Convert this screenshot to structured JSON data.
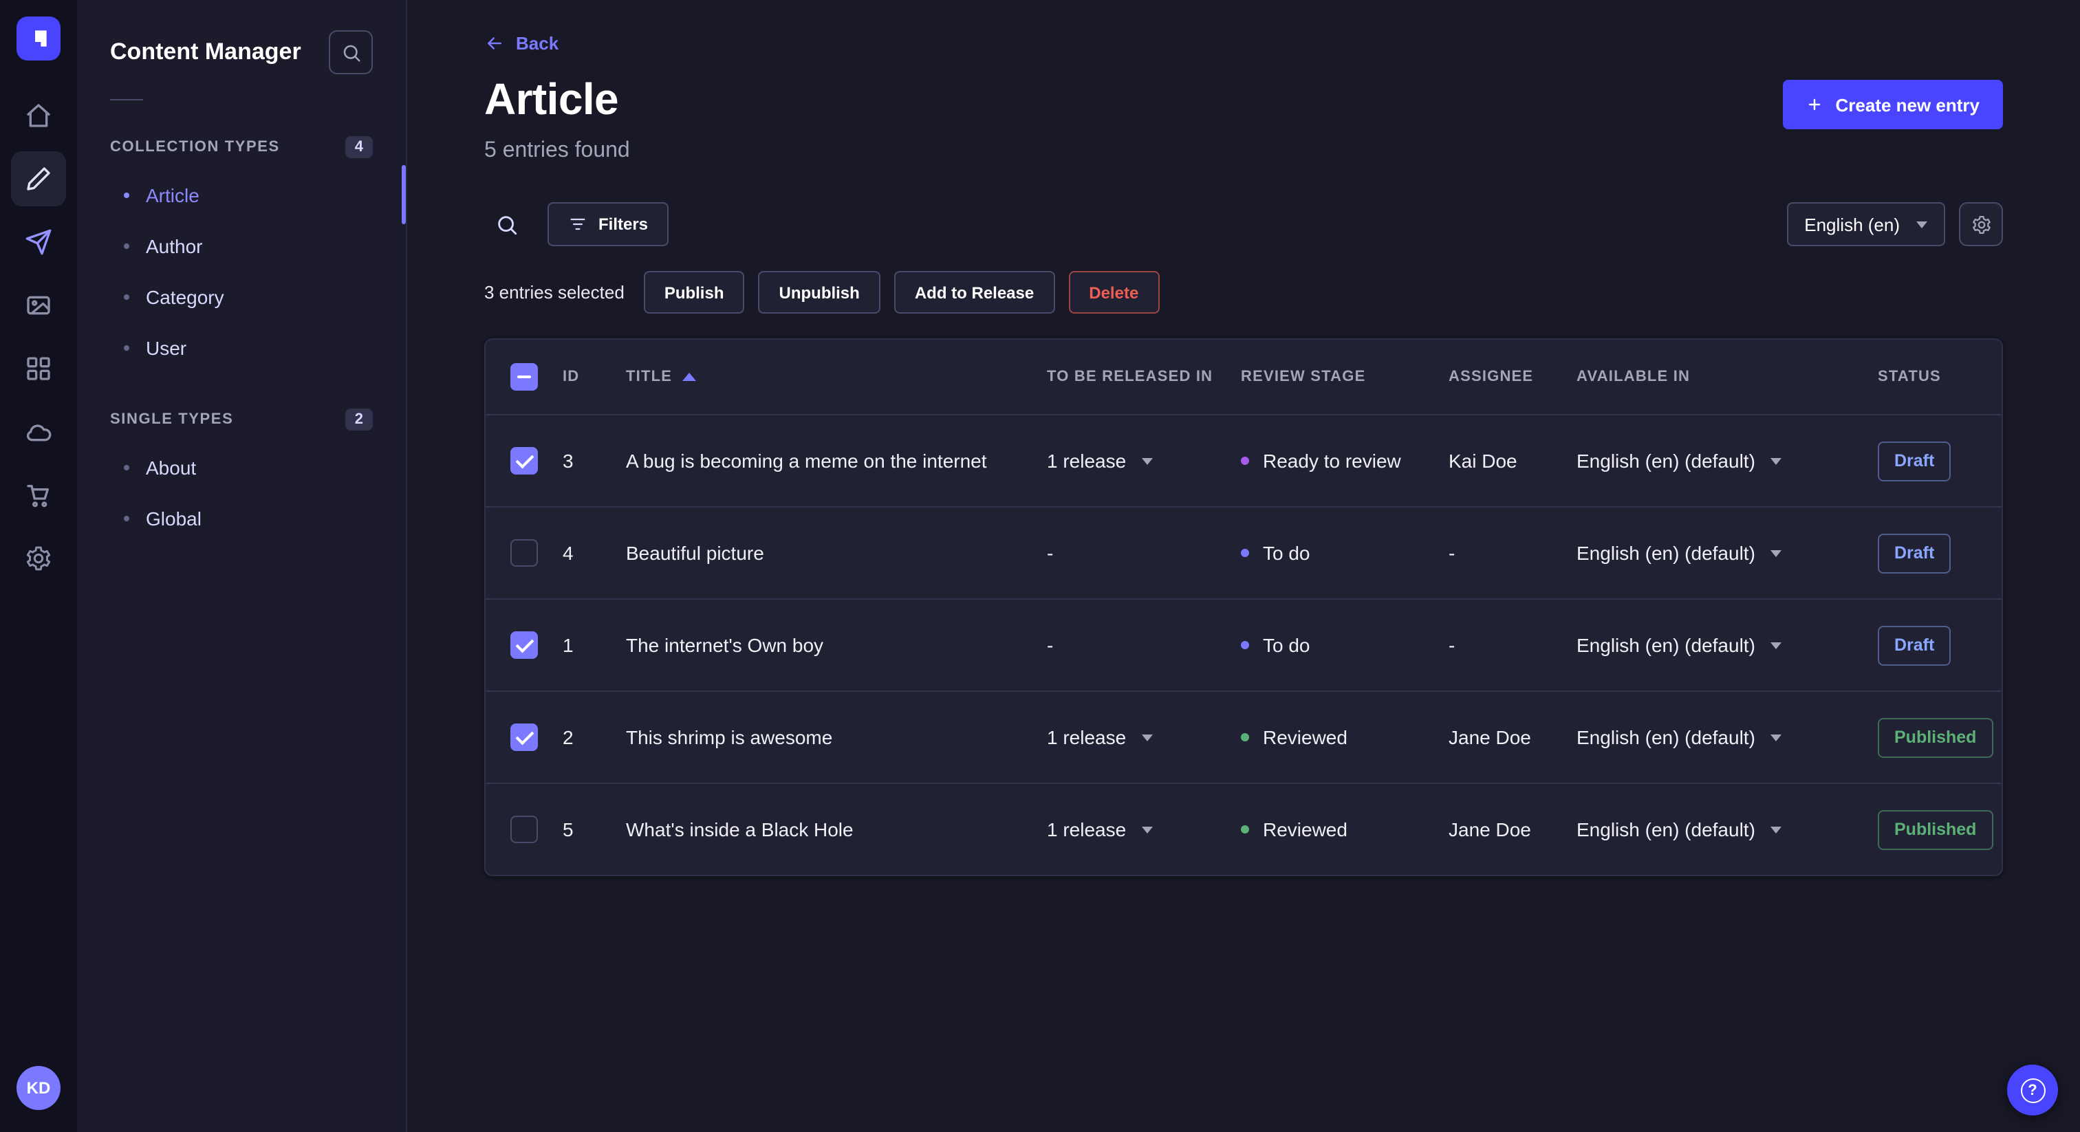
{
  "theme": {
    "primary": "#4945ff",
    "primary_light": "#7b79ff",
    "success": "#5cb176",
    "danger": "#ee5e52",
    "app_bg": "#181826",
    "card_bg": "#212134"
  },
  "rail": {
    "logo_icon": "strapi-logo",
    "items": [
      {
        "icon": "home-icon",
        "active": false
      },
      {
        "icon": "content-manager-icon",
        "active": true
      },
      {
        "icon": "releases-icon",
        "active": false
      },
      {
        "icon": "media-library-icon",
        "active": false
      },
      {
        "icon": "content-type-builder-icon",
        "active": false
      },
      {
        "icon": "cloud-icon",
        "active": false
      },
      {
        "icon": "marketplace-icon",
        "active": false
      },
      {
        "icon": "settings-icon",
        "active": false
      }
    ],
    "avatar_initials": "KD"
  },
  "subnav": {
    "title": "Content Manager",
    "search_icon": "search-icon",
    "sections": [
      {
        "label": "COLLECTION TYPES",
        "count": "4",
        "items": [
          {
            "label": "Article",
            "active": true
          },
          {
            "label": "Author",
            "active": false
          },
          {
            "label": "Category",
            "active": false
          },
          {
            "label": "User",
            "active": false
          }
        ]
      },
      {
        "label": "SINGLE TYPES",
        "count": "2",
        "items": [
          {
            "label": "About",
            "active": false
          },
          {
            "label": "Global",
            "active": false
          }
        ]
      }
    ]
  },
  "header": {
    "back_label": "Back",
    "title": "Article",
    "subtitle": "5 entries found",
    "create_label": "Create new entry"
  },
  "toolbar": {
    "search_icon": "search-icon",
    "filters_label": "Filters",
    "locale_value": "English (en)",
    "settings_icon": "gear-icon"
  },
  "selection": {
    "text": "3 entries selected",
    "actions": [
      "Publish",
      "Unpublish",
      "Add to Release",
      "Delete"
    ]
  },
  "table": {
    "select_all_state": "indeterminate",
    "headers": [
      "ID",
      "TITLE",
      "TO BE RELEASED IN",
      "REVIEW STAGE",
      "ASSIGNEE",
      "AVAILABLE IN",
      "STATUS"
    ],
    "sort": {
      "column": "TITLE",
      "direction": "asc"
    },
    "rows": [
      {
        "checked": true,
        "id": "3",
        "title": "A bug is becoming a meme on the internet",
        "release": "1 release",
        "release_menu": true,
        "stage": "Ready to review",
        "stage_color": "#a65ce8",
        "assignee": "Kai Doe",
        "locale": "English (en) (default)",
        "status": "Draft"
      },
      {
        "checked": false,
        "id": "4",
        "title": "Beautiful picture",
        "release": "-",
        "release_menu": false,
        "stage": "To do",
        "stage_color": "#7b79ff",
        "assignee": "-",
        "locale": "English (en) (default)",
        "status": "Draft"
      },
      {
        "checked": true,
        "id": "1",
        "title": "The internet's Own boy",
        "release": "-",
        "release_menu": false,
        "stage": "To do",
        "stage_color": "#7b79ff",
        "assignee": "-",
        "locale": "English (en) (default)",
        "status": "Draft"
      },
      {
        "checked": true,
        "id": "2",
        "title": "This shrimp is awesome",
        "release": "1 release",
        "release_menu": true,
        "stage": "Reviewed",
        "stage_color": "#5cb176",
        "assignee": "Jane Doe",
        "locale": "English (en) (default)",
        "status": "Published"
      },
      {
        "checked": false,
        "id": "5",
        "title": "What's inside a Black Hole",
        "release": "1 release",
        "release_menu": true,
        "stage": "Reviewed",
        "stage_color": "#5cb176",
        "assignee": "Jane Doe",
        "locale": "English (en) (default)",
        "status": "Published"
      }
    ]
  },
  "help": {
    "label": "?"
  }
}
